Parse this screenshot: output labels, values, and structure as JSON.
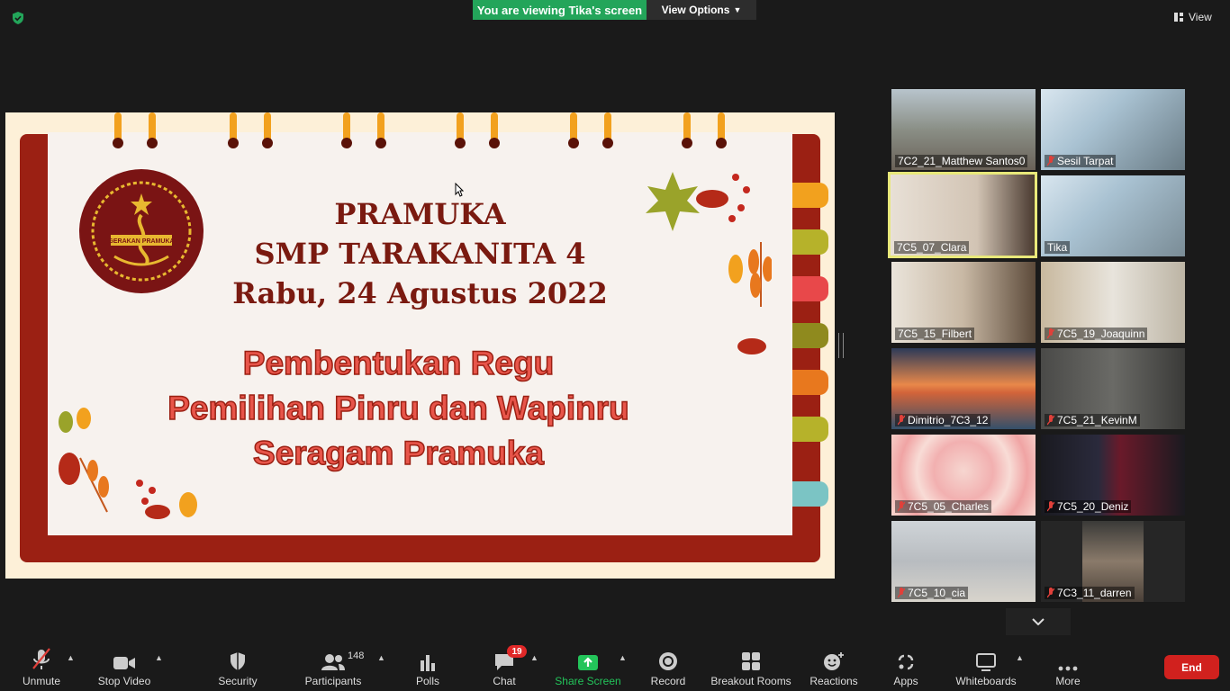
{
  "top_bar": {
    "viewing_banner": "You are viewing Tika's screen",
    "view_options_label": "View Options",
    "view_label": "View"
  },
  "slide": {
    "title_line1": "PRAMUKA",
    "title_line2": "SMP TARAKANITA 4",
    "title_line3": "Rabu, 24 Agustus 2022",
    "topic_line1": "Pembentukan Regu",
    "topic_line2": "Pemilihan Pinru dan Wapinru",
    "topic_line3": "Seragam Pramuka",
    "logo_text": "GERAKAN PRAMUKA"
  },
  "gallery": {
    "participants": [
      {
        "name": "7C2_21_Matthew Santos0",
        "muted": false
      },
      {
        "name": "Sesil Tarpat",
        "muted": true
      },
      {
        "name": "7C5_07_Clara",
        "muted": false,
        "active_speaker": true
      },
      {
        "name": "Tika",
        "muted": false
      },
      {
        "name": "7C5_15_Filbert",
        "muted": false
      },
      {
        "name": "7C5_19_Joaquinn",
        "muted": true
      },
      {
        "name": "Dimitrio_7C3_12",
        "muted": true
      },
      {
        "name": "7C5_21_KevinM",
        "muted": true
      },
      {
        "name": "7C5_05_Charles",
        "muted": true
      },
      {
        "name": "7C5_20_Deniz",
        "muted": true
      },
      {
        "name": "7C5_10_cia",
        "muted": true
      },
      {
        "name": "7C3_11_darren",
        "muted": true
      }
    ]
  },
  "toolbar": {
    "unmute": "Unmute",
    "stop_video": "Stop Video",
    "security": "Security",
    "participants": "Participants",
    "participant_count": "148",
    "polls": "Polls",
    "chat": "Chat",
    "chat_badge": "19",
    "share_screen": "Share Screen",
    "record": "Record",
    "breakout_rooms": "Breakout Rooms",
    "reactions": "Reactions",
    "apps": "Apps",
    "whiteboards": "Whiteboards",
    "more": "More",
    "end": "End"
  },
  "colors": {
    "share_green": "#23a55a",
    "end_red": "#d1211e",
    "slide_frame": "#9b2013",
    "active_speaker_border": "#e8e87a"
  }
}
